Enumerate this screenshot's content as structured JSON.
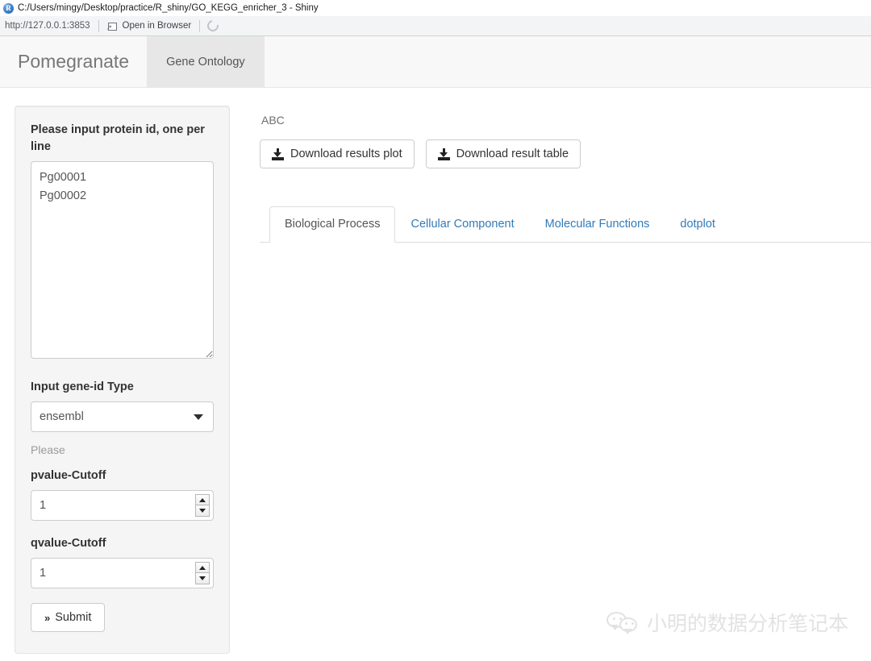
{
  "window": {
    "app_icon": "rstudio-r-icon",
    "title": "C:/Users/mingy/Desktop/practice/R_shiny/GO_KEGG_enricher_3 - Shiny"
  },
  "toolbar": {
    "url": "http://127.0.0.1:3853",
    "open_in_browser_label": "Open in Browser",
    "open_in_browser_icon": "external-link-icon",
    "refresh_icon": "refresh-icon"
  },
  "navbar": {
    "brand": "Pomegranate",
    "tabs": [
      {
        "label": "Gene Ontology",
        "active": true
      }
    ]
  },
  "sidebar": {
    "protein_input": {
      "label": "Please input protein id, one per line",
      "value": "Pg00001\nPg00002",
      "placeholder": ""
    },
    "gene_id_type": {
      "label": "Input gene-id Type",
      "value": "ensembl",
      "options": [
        "ensembl"
      ]
    },
    "help_text": "Please",
    "pvalue": {
      "label": "pvalue-Cutoff",
      "value": "1"
    },
    "qvalue": {
      "label": "qvalue-Cutoff",
      "value": "1"
    },
    "submit": {
      "label": "Submit",
      "icon": "double-chevron-right-icon"
    }
  },
  "main": {
    "status_text": "ABC",
    "downloads": [
      {
        "label": "Download results plot",
        "icon": "download-icon"
      },
      {
        "label": "Download result table",
        "icon": "download-icon"
      }
    ],
    "tabs": [
      {
        "label": "Biological Process",
        "active": true
      },
      {
        "label": "Cellular Component",
        "active": false
      },
      {
        "label": "Molecular Functions",
        "active": false
      },
      {
        "label": "dotplot",
        "active": false
      }
    ]
  },
  "watermark": {
    "icon": "wechat-icon",
    "text": "小明的数据分析笔记本"
  },
  "colors": {
    "link": "#337ab7",
    "navbar_bg": "#f8f8f8",
    "well_bg": "#f5f5f5",
    "watermark": "#e2e2e2"
  }
}
